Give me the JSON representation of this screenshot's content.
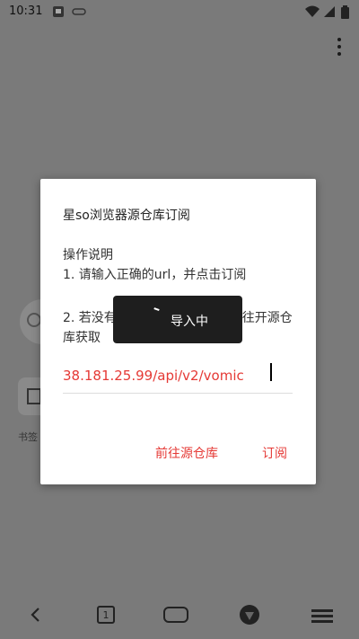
{
  "status_bar": {
    "time": "10:31"
  },
  "background": {
    "bookmark_label": "书签"
  },
  "dialog": {
    "title": "星so浏览器源仓库订阅",
    "section_title": "操作说明",
    "step1": "1. 请输入正确的url，并点击订阅",
    "step2": "2. 若没有源仓库地址，请点击前往开源仓库获取",
    "input_value": "38.181.25.99/api/v2/vomic",
    "btn_open_repo": "前往源仓库",
    "btn_subscribe": "订阅"
  },
  "toast": {
    "text": "导入中"
  },
  "bottom_nav": {
    "tab_count": "1"
  }
}
